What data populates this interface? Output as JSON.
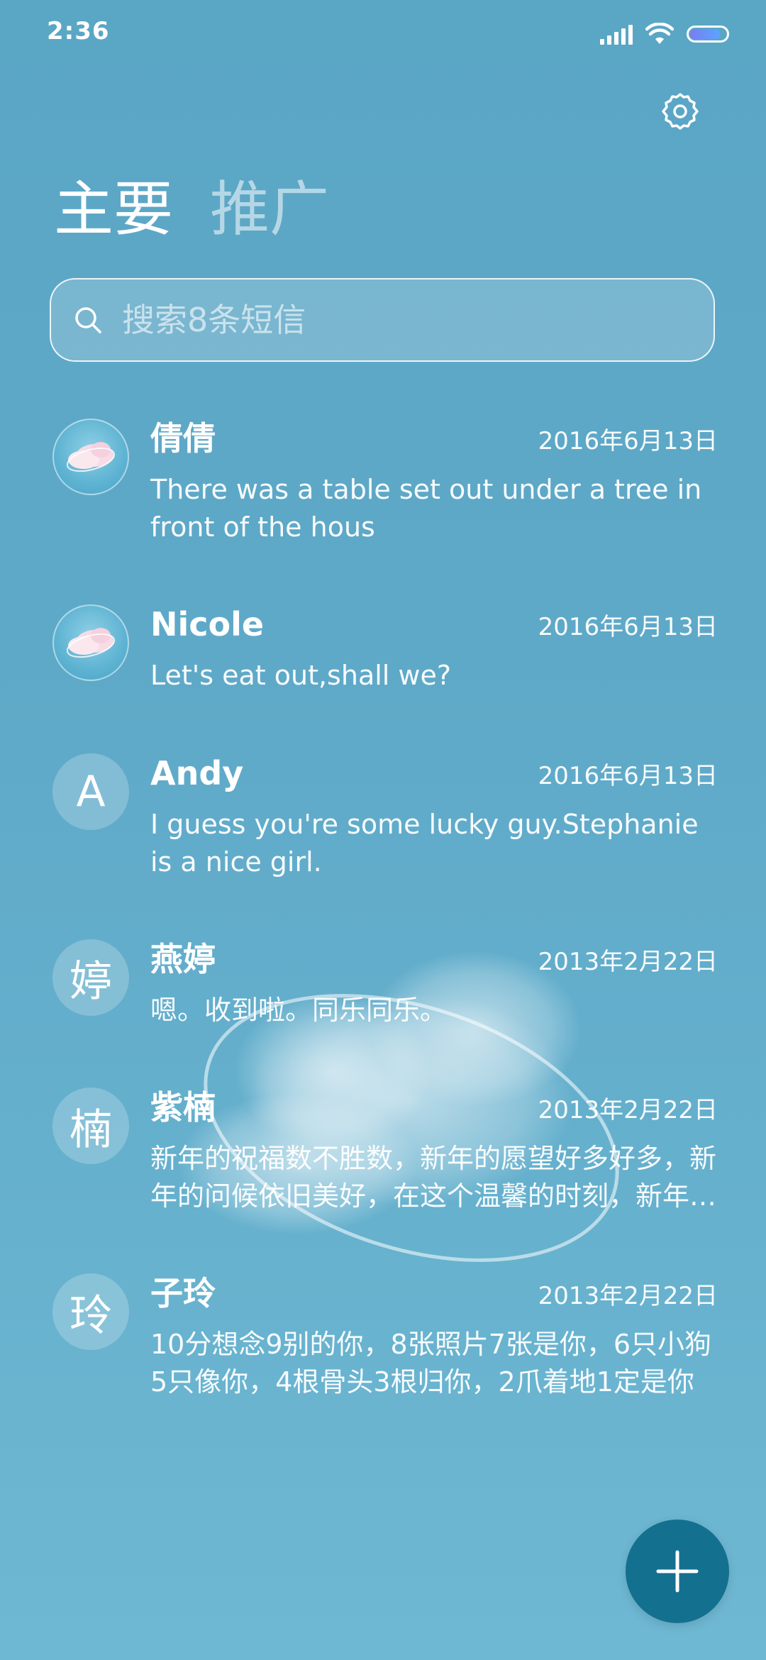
{
  "status_bar": {
    "time": "2:36",
    "icons": [
      "signal-icon",
      "wifi-icon",
      "battery-icon"
    ],
    "battery_level": 0.85
  },
  "header": {
    "tabs": [
      {
        "label": "主要",
        "active": true
      },
      {
        "label": "推广",
        "active": false
      }
    ],
    "settings_icon": "gear-icon"
  },
  "search": {
    "placeholder": "搜索8条短信",
    "icon": "search-icon"
  },
  "conversations": [
    {
      "avatar_type": "photo",
      "avatar_text": "",
      "name": "倩倩",
      "date": "2016年6月13日",
      "preview": "There was a table set out under a tree in front of the hous"
    },
    {
      "avatar_type": "photo",
      "avatar_text": "",
      "name": "Nicole",
      "date": "2016年6月13日",
      "preview": "Let's eat out,shall we?"
    },
    {
      "avatar_type": "letter",
      "avatar_text": "A",
      "name": "Andy",
      "date": "2016年6月13日",
      "preview": "I guess you're some lucky guy.Stephanie is a nice girl."
    },
    {
      "avatar_type": "letter",
      "avatar_text": "婷",
      "name": "燕婷",
      "date": "2013年2月22日",
      "preview": "嗯。收到啦。同乐同乐。"
    },
    {
      "avatar_type": "letter",
      "avatar_text": "楠",
      "name": "紫楠",
      "date": "2013年2月22日",
      "preview": "新年的祝福数不胜数，新年的愿望好多好多，新年的问候依旧美好，在这个温馨的时刻，新年快乐"
    },
    {
      "avatar_type": "letter",
      "avatar_text": "玲",
      "name": "子玲",
      "date": "2013年2月22日",
      "preview": "10分想念9别的你，8张照片7张是你，6只小狗5只像你，4根骨头3根归你，2爪着地1定是你"
    }
  ],
  "fab": {
    "icon": "plus-icon"
  },
  "colors": {
    "background": "#5fa9c8",
    "fab": "#14708f",
    "text": "#ffffff"
  }
}
